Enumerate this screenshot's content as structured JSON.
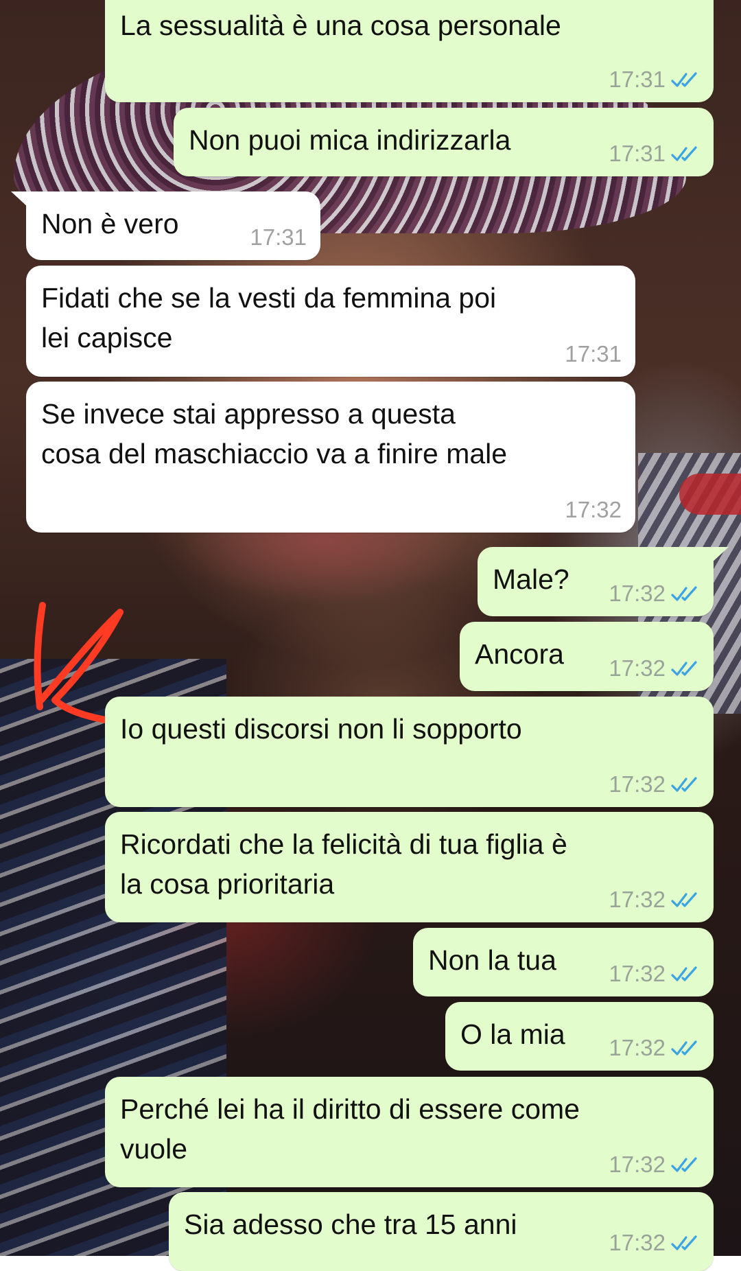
{
  "colors": {
    "outgoing_bubble": "#e2fdcb",
    "incoming_bubble": "#ffffff",
    "read_tick": "#3aa3e3",
    "annotation_mark": "#ff3b24"
  },
  "icons": {
    "read_receipt": "double-check-icon"
  },
  "messages": [
    {
      "text": "La sessualità è una cosa personale",
      "time": "17:31",
      "outgoing": true
    },
    {
      "text": "Non puoi mica indirizzarla",
      "time": "17:31",
      "outgoing": true
    },
    {
      "text": "Non è vero",
      "time": "17:31",
      "outgoing": false
    },
    {
      "text": "Fidati che se la vesti da femmina poi\nlei capisce",
      "time": "17:31",
      "outgoing": false
    },
    {
      "text": "Se invece stai appresso a questa\ncosa del maschiaccio va a finire male",
      "time": "17:32",
      "outgoing": false
    },
    {
      "text": "Male?",
      "time": "17:32",
      "outgoing": true
    },
    {
      "text": "Ancora",
      "time": "17:32",
      "outgoing": true
    },
    {
      "text": "Io questi discorsi non li sopporto",
      "time": "17:32",
      "outgoing": true
    },
    {
      "text": "Ricordati che la felicità di tua figlia è\nla cosa prioritaria",
      "time": "17:32",
      "outgoing": true
    },
    {
      "text": "Non la tua",
      "time": "17:32",
      "outgoing": true
    },
    {
      "text": "O la mia",
      "time": "17:32",
      "outgoing": true
    },
    {
      "text": "Perché lei ha il diritto di essere come\nvuole",
      "time": "17:32",
      "outgoing": true
    },
    {
      "text": "Sia adesso che tra 15 anni",
      "time": "17:32",
      "outgoing": true
    }
  ]
}
